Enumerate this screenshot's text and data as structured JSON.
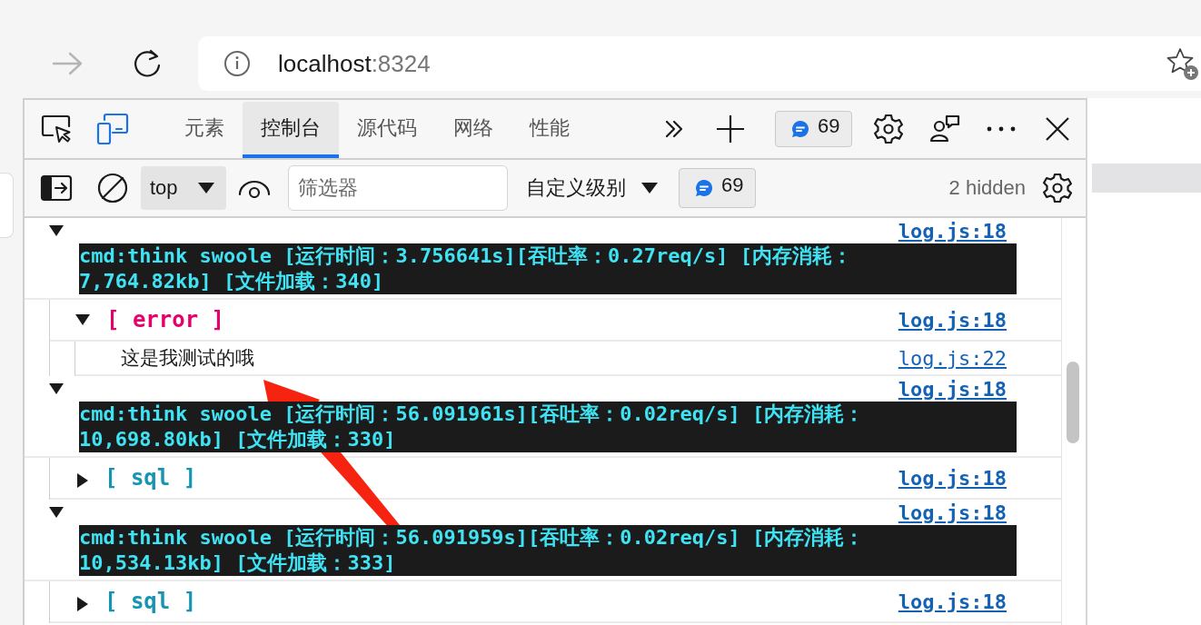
{
  "browser": {
    "host": "localhost",
    "port": ":8324"
  },
  "devtools": {
    "tabs": [
      {
        "label": "元素",
        "selected": false
      },
      {
        "label": "控制台",
        "selected": true
      },
      {
        "label": "源代码",
        "selected": false
      },
      {
        "label": "网络",
        "selected": false
      },
      {
        "label": "性能",
        "selected": false
      }
    ],
    "message_badge": "69"
  },
  "console_toolbar": {
    "context": "top",
    "filter": {
      "placeholder": "筛选器"
    },
    "level": "自定义级别",
    "message_badge": "69",
    "hidden": "2 hidden"
  },
  "messages": [
    {
      "kind": "group",
      "expanded": true,
      "source": "log.js:18",
      "lines": [
        "cmd:think swoole [运行时间：3.756641s][吞吐率：0.27req/s] [内存消耗：",
        "7,764.82kb] [文件加载：340]"
      ],
      "children": [
        {
          "kind": "label",
          "expanded": true,
          "text": "[ error ]",
          "color": "#e6006b",
          "source": "log.js:18",
          "children": [
            {
              "kind": "text",
              "text": "这是我测试的哦",
              "source": "log.js:22"
            }
          ]
        }
      ]
    },
    {
      "kind": "group",
      "expanded": true,
      "source": "log.js:18",
      "lines": [
        "cmd:think swoole [运行时间：56.091961s][吞吐率：0.02req/s] [内存消耗：",
        "10,698.80kb] [文件加载：330]"
      ],
      "children": [
        {
          "kind": "label",
          "expanded": false,
          "text": "[ sql ]",
          "color": "#1595b3",
          "source": "log.js:18"
        }
      ]
    },
    {
      "kind": "group",
      "expanded": true,
      "source": "log.js:18",
      "lines": [
        "cmd:think swoole [运行时间：56.091959s][吞吐率：0.02req/s] [内存消耗：",
        "10,534.13kb] [文件加载：333]"
      ],
      "children": [
        {
          "kind": "label",
          "expanded": false,
          "text": "[ sql ]",
          "color": "#1595b3",
          "source": "log.js:18"
        }
      ]
    }
  ]
}
